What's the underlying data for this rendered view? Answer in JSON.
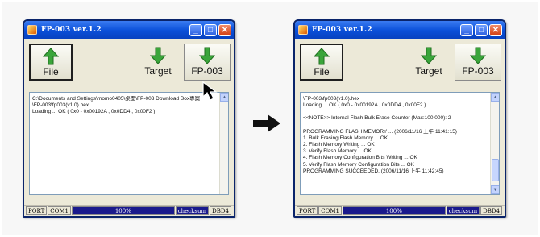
{
  "left_window": {
    "title": "FP-003   ver.1.2",
    "controls": {
      "minimize": "_",
      "maximize": "□",
      "close": "✕"
    },
    "toolbar": {
      "file_label": "File",
      "target_label": "Target",
      "fp_label": "FP-003"
    },
    "log_lines": [
      "C:\\Documents and Settings\\momo0405\\桌面\\FP-003 Download Box專案",
      "\\FP-003\\fp003(v1.0).hex",
      "Loading ... OK ( 0x0 - 0x00192A , 0x0DD4 , 0x00F2 )"
    ],
    "status": {
      "port_label": "PORT",
      "port_value": "COM1",
      "progress": "100%",
      "checksum_label": "checksum",
      "checksum_value": "DBD4"
    }
  },
  "right_window": {
    "title": "FP-003   ver.1.2",
    "controls": {
      "minimize": "_",
      "maximize": "□",
      "close": "✕"
    },
    "toolbar": {
      "file_label": "File",
      "target_label": "Target",
      "fp_label": "FP-003"
    },
    "log_lines": [
      "\\FP-003\\fp003(v1.0).hex",
      "Loading ... OK ( 0x0 - 0x00192A , 0x0DD4 , 0x00F2 )",
      "",
      "<<NOTE>> Internal Flash Bulk Erase Counter (Max:100,000): 2",
      "",
      "PROGRAMMING FLASH MEMORY ... (2006/11/16 上午 11:41:15)",
      "1. Bulk Erasing Flash Memory ... OK",
      "2. Flash Memory Writing ... OK",
      "3. Verify Flash Memory ... OK",
      "4. Flash Memory Configuration Bits Writing ... OK",
      "5. Verify Flash Memory Configuration Bits ... OK",
      "PROGRAMMING SUCCEEDED. (2006/11/16 上午 11:42:45)"
    ],
    "status": {
      "port_label": "PORT",
      "port_value": "COM1",
      "progress": "100%",
      "checksum_label": "checksum",
      "checksum_value": "DBD4"
    }
  },
  "colors": {
    "titlebar": "#0a4fd8",
    "arrow_green": "#3aa53a",
    "status_blue": "#1a1a8c"
  },
  "icons": [
    "app-icon",
    "up-arrow-icon",
    "down-arrow-icon",
    "cursor-icon",
    "right-arrow-icon"
  ]
}
